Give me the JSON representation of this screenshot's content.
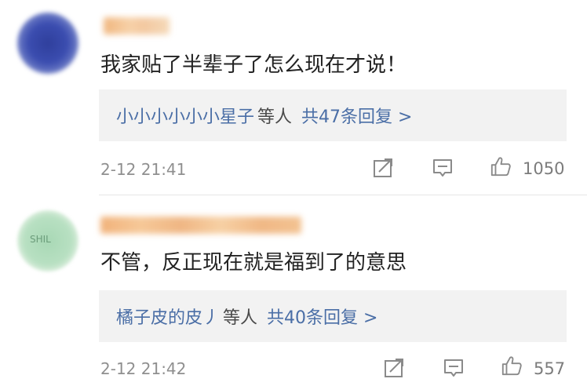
{
  "comments": [
    {
      "content": "我家贴了半辈子了怎么现在才说！",
      "replies": {
        "names": "小小小小小小星子",
        "suffix": "等人",
        "count_label": "共47条回复 >"
      },
      "timestamp": "2-12 21:41",
      "likes": "1050"
    },
    {
      "avatar_mark": "SHIL",
      "content": "不管，反正现在就是福到了的意思",
      "replies": {
        "names": "橘子皮的皮丿",
        "suffix": "等人",
        "count_label": "共40条回复 >"
      },
      "timestamp": "2-12 21:42",
      "likes": "557"
    }
  ],
  "icons": {
    "share": "share-icon",
    "reply": "comment-icon",
    "like": "thumbs-up-icon"
  },
  "colors": {
    "link": "#4a6ea6",
    "meta": "#8f8f8f",
    "reply_bg": "#f2f2f2"
  }
}
